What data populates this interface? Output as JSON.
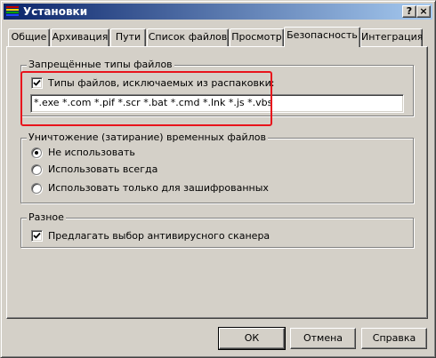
{
  "window": {
    "title": "Установки",
    "help_button": "?",
    "close_button": "×"
  },
  "tabs": [
    {
      "label": "Общие",
      "active": false
    },
    {
      "label": "Архивация",
      "active": false
    },
    {
      "label": "Пути",
      "active": false
    },
    {
      "label": "Список файлов",
      "active": false
    },
    {
      "label": "Просмотр",
      "active": false
    },
    {
      "label": "Безопасность",
      "active": true
    },
    {
      "label": "Интеграция",
      "active": false
    }
  ],
  "forbidden_types": {
    "legend": "Запрещённые типы файлов",
    "checkbox_label": "Типы файлов, исключаемых из распаковки:",
    "checkbox_checked": true,
    "field_value": "*.exe *.com *.pif *.scr *.bat *.cmd *.lnk *.js *.vbs"
  },
  "temp_wipe": {
    "legend": "Уничтожение (затирание) временных файлов",
    "options": [
      {
        "label": "Не использовать",
        "selected": true
      },
      {
        "label": "Использовать всегда",
        "selected": false
      },
      {
        "label": "Использовать только для зашифрованных",
        "selected": false
      }
    ]
  },
  "misc": {
    "legend": "Разное",
    "checkbox_label": "Предлагать выбор антивирусного сканера",
    "checkbox_checked": true
  },
  "buttons": {
    "ok": "ОК",
    "cancel": "Отмена",
    "help": "Справка"
  },
  "colors": {
    "title_bar_start": "#0a246a",
    "title_bar_end": "#a6caf0",
    "dialog_face": "#d4d0c8",
    "highlight_annotation": "#e8141c"
  }
}
